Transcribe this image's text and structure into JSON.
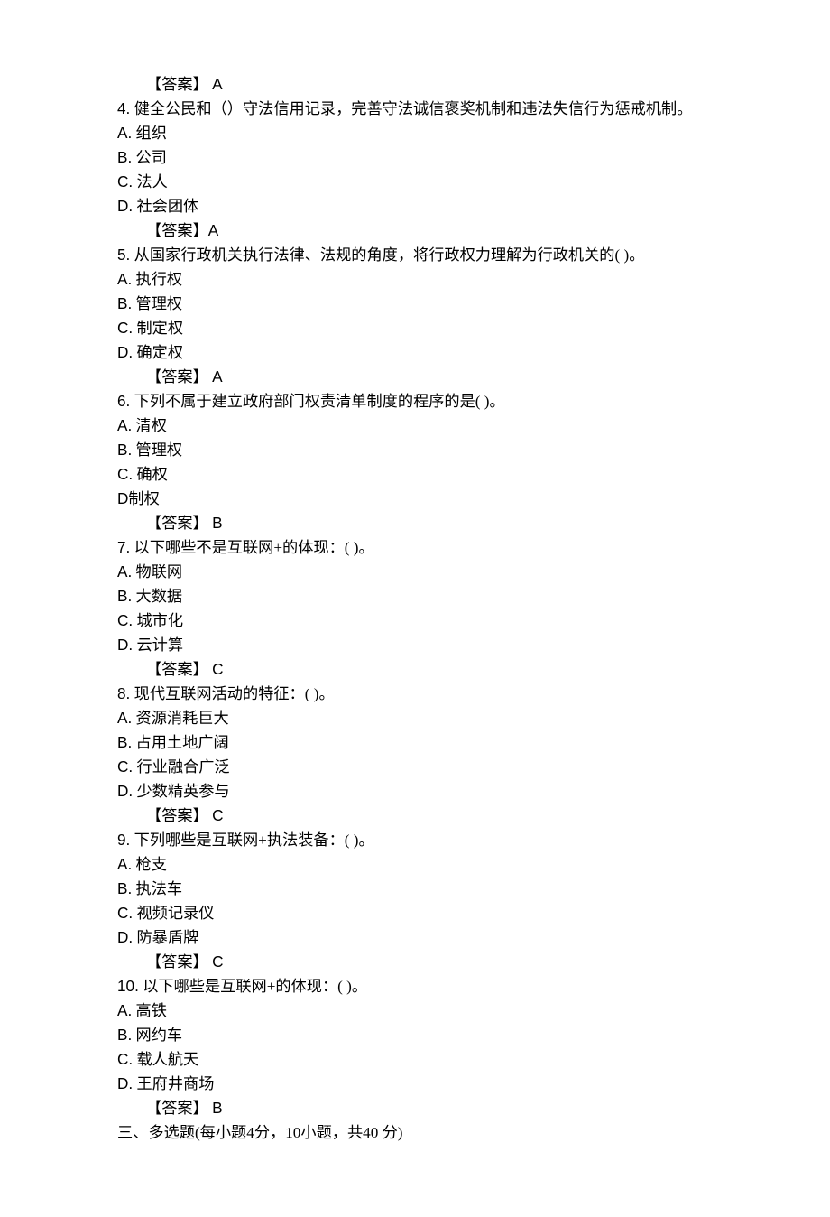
{
  "prev_answer": {
    "label": "【答案】",
    "value": "A"
  },
  "questions": [
    {
      "num": "4.",
      "text": "健全公民和（）守法信用记录，完善守法诚信褒奖机制和违法失信行为惩戒机制。",
      "options": [
        {
          "letter": "A.",
          "text": "组织"
        },
        {
          "letter": "B.",
          "text": "公司"
        },
        {
          "letter": "C.",
          "text": "法人"
        },
        {
          "letter": "D.",
          "text": "社会团体"
        }
      ],
      "answer_label": "【答案】",
      "answer": "A"
    },
    {
      "num": "5.",
      "text": "从国家行政机关执行法律、法规的角度，将行政权力理解为行政机关的( )。",
      "options": [
        {
          "letter": "A.",
          "text": "执行权"
        },
        {
          "letter": "B.",
          "text": "管理权"
        },
        {
          "letter": "C.",
          "text": "制定权"
        },
        {
          "letter": "D.",
          "text": "确定权"
        }
      ],
      "answer_label": "【答案】",
      "answer": "A"
    },
    {
      "num": "6.",
      "text": "下列不属于建立政府部门权责清单制度的程序的是( )。",
      "options": [
        {
          "letter": "A.",
          "text": "清权"
        },
        {
          "letter": "B.",
          "text": "管理权"
        },
        {
          "letter": "C.",
          "text": "确权"
        },
        {
          "letter": "D",
          "text": "制权",
          "no_dot": true
        }
      ],
      "answer_label": "【答案】",
      "answer": "B"
    },
    {
      "num": "7.",
      "text": "以下哪些不是互联网+的体现：( )。",
      "options": [
        {
          "letter": "A.",
          "text": "物联网"
        },
        {
          "letter": "B.",
          "text": "大数据"
        },
        {
          "letter": "C.",
          "text": "城市化"
        },
        {
          "letter": "D.",
          "text": "云计算"
        }
      ],
      "answer_label": "【答案】",
      "answer": "C"
    },
    {
      "num": "8.",
      "text": "现代互联网活动的特征：( )。",
      "options": [
        {
          "letter": "A.",
          "text": "资源消耗巨大"
        },
        {
          "letter": "B.",
          "text": "占用土地广阔"
        },
        {
          "letter": "C.",
          "text": "行业融合广泛"
        },
        {
          "letter": "D.",
          "text": "少数精英参与"
        }
      ],
      "answer_label": "【答案】",
      "answer": "C"
    },
    {
      "num": "9.",
      "text": "下列哪些是互联网+执法装备：( )。",
      "options": [
        {
          "letter": "A.",
          "text": "枪支"
        },
        {
          "letter": "B.",
          "text": "执法车"
        },
        {
          "letter": "C.",
          "text": "视频记录仪"
        },
        {
          "letter": "D.",
          "text": "防暴盾牌"
        }
      ],
      "answer_label": "【答案】",
      "answer": "C"
    },
    {
      "num": "10.",
      "text": "以下哪些是互联网+的体现：( )。",
      "options": [
        {
          "letter": "A.",
          "text": "高铁"
        },
        {
          "letter": "B.",
          "text": "网约车"
        },
        {
          "letter": "C.",
          "text": "载人航天"
        },
        {
          "letter": "D.",
          "text": "王府井商场"
        }
      ],
      "answer_label": "【答案】",
      "answer": "B"
    }
  ],
  "section_header": "三、多选题(每小题4分，10小题，共40 分)"
}
